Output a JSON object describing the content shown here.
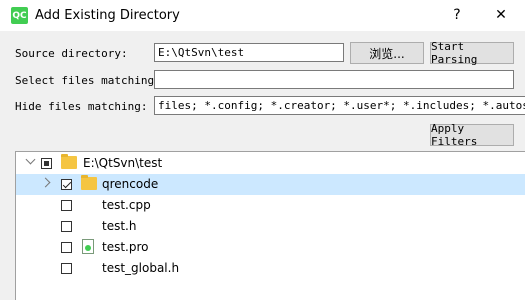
{
  "window": {
    "title": "Add Existing Directory",
    "app_icon_text": "QC",
    "help_label": "?",
    "close_label": "✕"
  },
  "source_directory": {
    "label": "Source directory:",
    "value": "E:\\QtSvn\\test",
    "browse_label": "浏览...",
    "start_parsing_label": "Start Parsing"
  },
  "select_files": {
    "label": "Select files matching:",
    "value": ""
  },
  "hide_files": {
    "label": "Hide files matching:",
    "value": "files; *.config; *.creator; *.user*; *.includes; *.autosave"
  },
  "apply_filters_label": "Apply Filters",
  "tree": {
    "root": {
      "label": "E:\\QtSvn\\test",
      "check_state": "partial",
      "expanded": true
    },
    "items": [
      {
        "label": "qrencode",
        "type": "folder",
        "check_state": "checked",
        "selected": true
      },
      {
        "label": "test.cpp",
        "type": "file",
        "check_state": "unchecked"
      },
      {
        "label": "test.h",
        "type": "file",
        "check_state": "unchecked"
      },
      {
        "label": "test.pro",
        "type": "pro-file",
        "check_state": "unchecked"
      },
      {
        "label": "test_global.h",
        "type": "file",
        "check_state": "unchecked"
      }
    ]
  },
  "colors": {
    "selection": "#cce8ff",
    "qt_green": "#41cd52",
    "folder": "#f5c542"
  }
}
